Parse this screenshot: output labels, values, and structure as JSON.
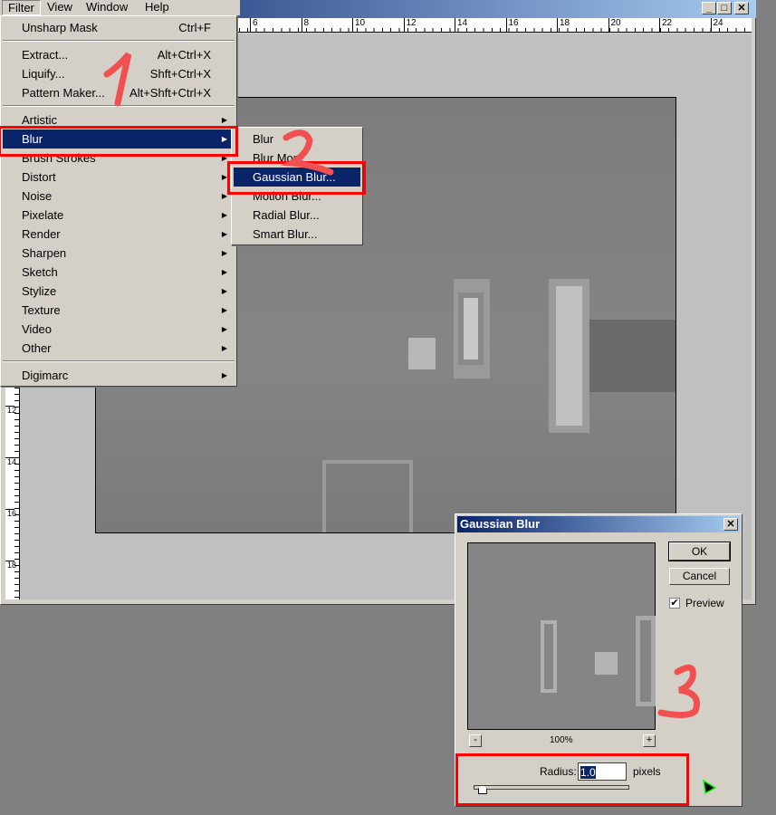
{
  "menubar": {
    "items": [
      "Filter",
      "View",
      "Window",
      "Help"
    ]
  },
  "window_controls": {
    "minimize": "_",
    "maximize": "□",
    "close": "✕"
  },
  "rulers": {
    "horizontal": [
      "6",
      "8",
      "10",
      "12",
      "14",
      "16",
      "18",
      "20",
      "22",
      "24"
    ],
    "vertical": [
      "12",
      "14",
      "16",
      "18"
    ]
  },
  "filter_menu": {
    "top": [
      {
        "label": "Unsharp Mask",
        "shortcut": "Ctrl+F"
      }
    ],
    "group2": [
      {
        "label": "Extract...",
        "shortcut": "Alt+Ctrl+X"
      },
      {
        "label": "Liquify...",
        "shortcut": "Shft+Ctrl+X"
      },
      {
        "label": "Pattern Maker...",
        "shortcut": "Alt+Shft+Ctrl+X"
      }
    ],
    "submenus": [
      "Artistic",
      "Blur",
      "Brush Strokes",
      "Distort",
      "Noise",
      "Pixelate",
      "Render",
      "Sharpen",
      "Sketch",
      "Stylize",
      "Texture",
      "Video",
      "Other"
    ],
    "last": "Digimarc",
    "selected": "Blur"
  },
  "blur_submenu": {
    "items": [
      "Blur",
      "Blur More",
      "Gaussian Blur...",
      "Motion Blur...",
      "Radial Blur...",
      "Smart Blur..."
    ],
    "selected": "Gaussian Blur..."
  },
  "dialog": {
    "title": "Gaussian Blur",
    "ok": "OK",
    "cancel": "Cancel",
    "preview_label": "Preview",
    "preview_checked": true,
    "zoom_out": "-",
    "zoom_in": "+",
    "zoom_level": "100%",
    "radius_label": "Radius:",
    "radius_value": "1.0",
    "units": "pixels",
    "slider_fraction": 0.03
  },
  "annotations": [
    "1",
    "2",
    "3"
  ],
  "colors": {
    "highlight": "#0a246a",
    "annotation": "#ff0000",
    "face": "#d4d0c8"
  }
}
